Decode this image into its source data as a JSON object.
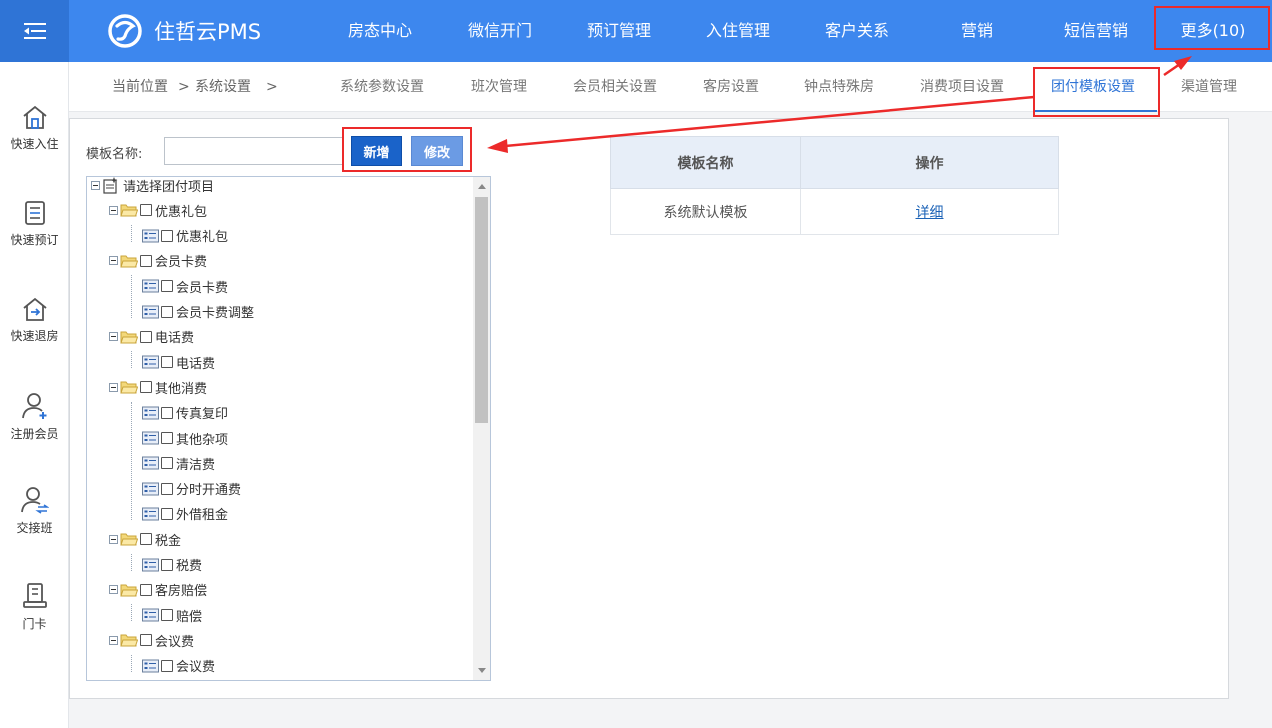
{
  "brand": {
    "name": "住哲云PMS"
  },
  "top_nav": [
    {
      "label": "房态中心"
    },
    {
      "label": "微信开门"
    },
    {
      "label": "预订管理"
    },
    {
      "label": "入住管理"
    },
    {
      "label": "客户关系"
    },
    {
      "label": "营销"
    },
    {
      "label": "短信营销"
    },
    {
      "label": "更多(10)"
    }
  ],
  "sidebar": [
    {
      "label": "快速入住",
      "icon": "home-checkin-icon"
    },
    {
      "label": "快速预订",
      "icon": "booking-list-icon"
    },
    {
      "label": "快速退房",
      "icon": "checkout-icon"
    },
    {
      "label": "注册会员",
      "icon": "register-member-icon"
    },
    {
      "label": "交接班",
      "icon": "shift-handover-icon"
    },
    {
      "label": "门卡",
      "icon": "room-card-icon"
    }
  ],
  "breadcrumb": {
    "current": "当前位置",
    "sep1": ">",
    "section": "系统设置",
    "sep2": ">"
  },
  "sub_tabs": [
    {
      "label": "系统参数设置"
    },
    {
      "label": "班次管理"
    },
    {
      "label": "会员相关设置"
    },
    {
      "label": "客房设置"
    },
    {
      "label": "钟点特殊房"
    },
    {
      "label": "消费项目设置"
    },
    {
      "label": "团付模板设置",
      "active": true
    },
    {
      "label": "渠道管理"
    }
  ],
  "form": {
    "template_name_label": "模板名称:",
    "template_name_value": "",
    "add_button": "新增",
    "edit_button": "修改"
  },
  "tree": {
    "root": "请选择团付项目",
    "groups": [
      {
        "label": "优惠礼包",
        "children": [
          "优惠礼包"
        ]
      },
      {
        "label": "会员卡费",
        "children": [
          "会员卡费",
          "会员卡费调整"
        ]
      },
      {
        "label": "电话费",
        "children": [
          "电话费"
        ]
      },
      {
        "label": "其他消费",
        "children": [
          "传真复印",
          "其他杂项",
          "清洁费",
          "分时开通费",
          "外借租金"
        ]
      },
      {
        "label": "税金",
        "children": [
          "税费"
        ]
      },
      {
        "label": "客房赔偿",
        "children": [
          "赔偿"
        ]
      },
      {
        "label": "会议费",
        "children": [
          "会议费"
        ]
      }
    ]
  },
  "table": {
    "headers": [
      "模板名称",
      "操作"
    ],
    "rows": [
      {
        "name": "系统默认模板",
        "action": "详细"
      }
    ]
  },
  "colors": {
    "nav_blue": "#3d87ee",
    "nav_blue_dark": "#2f74d6",
    "annotation_red": "#ec2a2a",
    "add_button": "#1a63c9",
    "edit_button": "#6b9be4"
  }
}
